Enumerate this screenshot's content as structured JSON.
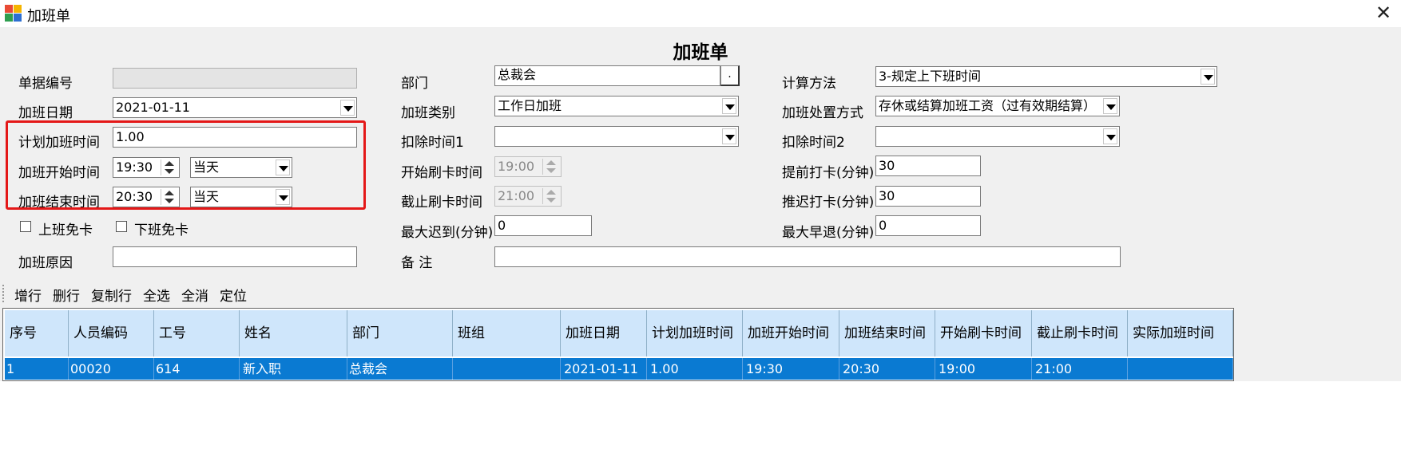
{
  "window": {
    "title": "加班单"
  },
  "form": {
    "title": "加班单",
    "doc_no": {
      "label": "单据编号",
      "value": ""
    },
    "date": {
      "label": "加班日期",
      "value": "2021-01-11"
    },
    "plan_hours": {
      "label": "计划加班时间",
      "value": "1.00"
    },
    "start_time": {
      "label": "加班开始时间",
      "value": "19:30",
      "day": "当天"
    },
    "end_time": {
      "label": "加班结束时间",
      "value": "20:30",
      "day": "当天"
    },
    "no_card_on": {
      "label": "上班免卡"
    },
    "no_card_off": {
      "label": "下班免卡"
    },
    "reason": {
      "label": "加班原因",
      "value": ""
    },
    "dept": {
      "label": "部门",
      "value": "总裁会",
      "button": "."
    },
    "ot_type": {
      "label": "加班类别",
      "value": "工作日加班"
    },
    "deduct1": {
      "label": "扣除时间1",
      "value": ""
    },
    "card_start": {
      "label": "开始刷卡时间",
      "value": "19:00"
    },
    "card_end": {
      "label": "截止刷卡时间",
      "value": "21:00"
    },
    "max_late": {
      "label": "最大迟到(分钟)",
      "value": "0"
    },
    "remark": {
      "label": "备   注",
      "value": ""
    },
    "calc_method": {
      "label": "计算方法",
      "value": "3-规定上下班时间"
    },
    "disposal": {
      "label": "加班处置方式",
      "value": "存休或结算加班工资（过有效期结算）"
    },
    "deduct2": {
      "label": "扣除时间2",
      "value": ""
    },
    "early_punch": {
      "label": "提前打卡(分钟)",
      "value": "30"
    },
    "late_punch": {
      "label": "推迟打卡(分钟)",
      "value": "30"
    },
    "max_early_leave": {
      "label": "最大早退(分钟)",
      "value": "0"
    }
  },
  "toolbar": {
    "add_row": "增行",
    "delete_row": "删行",
    "copy_row": "复制行",
    "select_all": "全选",
    "deselect_all": "全消",
    "locate": "定位"
  },
  "table": {
    "headers": [
      "序号",
      "人员编码",
      "工号",
      "姓名",
      "部门",
      "班组",
      "加班日期",
      "计划加班时间",
      "加班开始时间",
      "加班结束时间",
      "开始刷卡时间",
      "截止刷卡时间",
      "实际加班时间"
    ],
    "rows": [
      [
        "1",
        "00020",
        "614",
        "新入职",
        "总裁会",
        "",
        "2021-01-11",
        "1.00",
        "19:30",
        "20:30",
        "19:00",
        "21:00",
        ""
      ]
    ]
  },
  "colors": {
    "highlight_border": "#e41818",
    "selected_row": "#0a7ad2",
    "header_bg": "#cfe6fb"
  }
}
